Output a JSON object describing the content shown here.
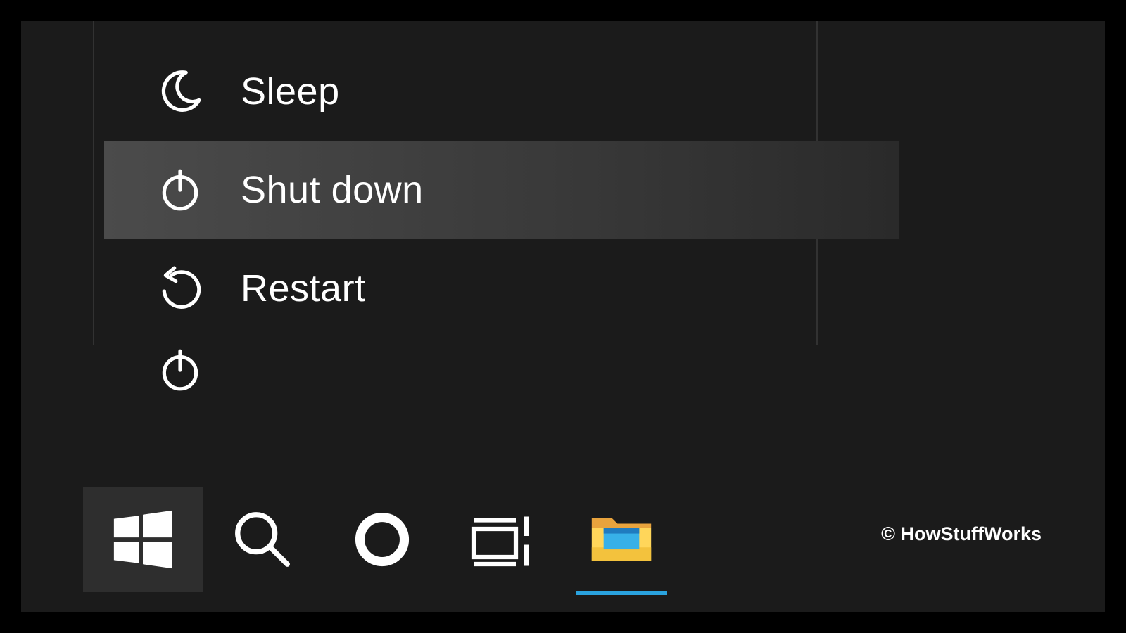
{
  "power_menu": {
    "items": [
      {
        "id": "sleep",
        "label": "Sleep",
        "hover": false
      },
      {
        "id": "shutdown",
        "label": "Shut down",
        "hover": true
      },
      {
        "id": "restart",
        "label": "Restart",
        "hover": false
      }
    ]
  },
  "taskbar": {
    "items": [
      {
        "id": "start",
        "name": "start-button",
        "active": true,
        "running": false
      },
      {
        "id": "search",
        "name": "search-button",
        "active": false,
        "running": false
      },
      {
        "id": "cortana",
        "name": "cortana-button",
        "active": false,
        "running": false
      },
      {
        "id": "taskview",
        "name": "task-view-button",
        "active": false,
        "running": false
      },
      {
        "id": "file-explorer",
        "name": "file-explorer-button",
        "active": false,
        "running": true
      }
    ]
  },
  "attribution": "© HowStuffWorks"
}
